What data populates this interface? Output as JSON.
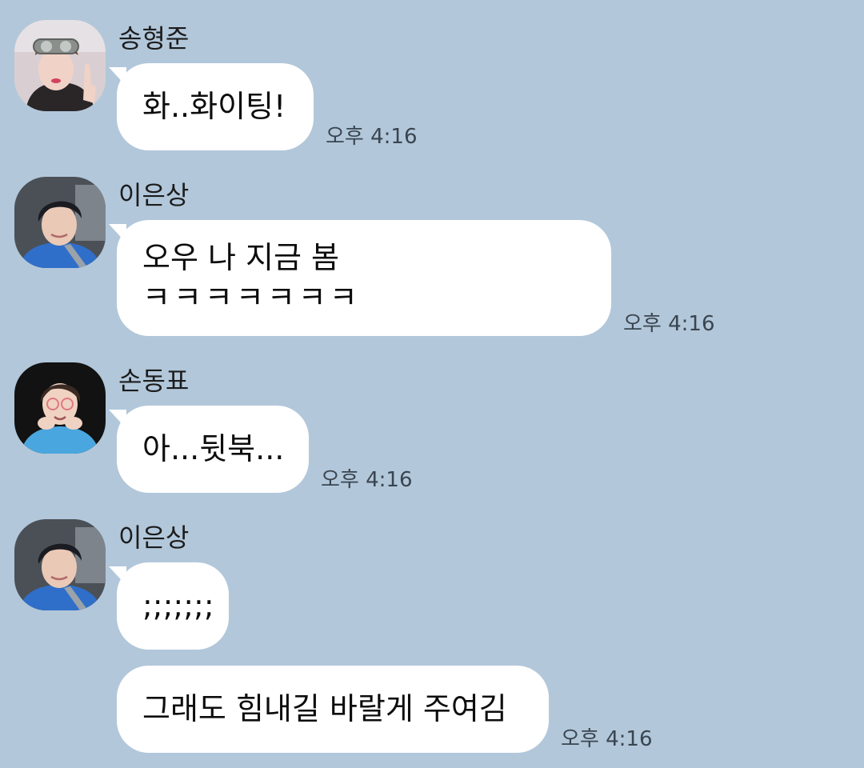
{
  "chat": {
    "messages": [
      {
        "sender": "송형준",
        "text": "화..화이팅!",
        "time": "오후 4:16"
      },
      {
        "sender": "이은상",
        "lines": [
          "오우 나 지금 봄",
          "ㅋㅋㅋㅋㅋㅋㅋ"
        ],
        "time": "오후 4:16"
      },
      {
        "sender": "손동표",
        "text": "아...뒷북...",
        "time": "오후 4:16"
      },
      {
        "sender": "이은상",
        "text": ";;;;;;;",
        "time": ""
      },
      {
        "sender": "",
        "text": "그래도 힘내길 바랄게 주여김",
        "time": "오후 4:16"
      }
    ]
  },
  "colors": {
    "background": "#b2c7da",
    "bubble": "#ffffff"
  },
  "icons": {
    "avatar": "profile-photo"
  }
}
